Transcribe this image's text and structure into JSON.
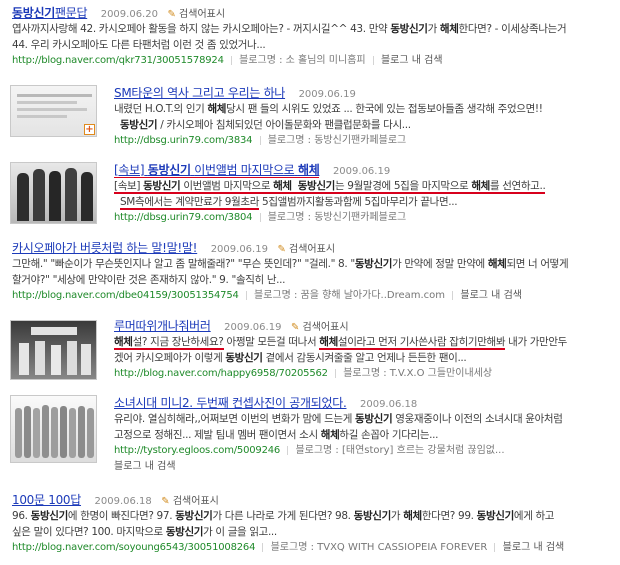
{
  "blog_search_label": "검색어표시",
  "blog_inside_search": "블로그 내 검색",
  "results": [
    {
      "title": "동방신기팬문답",
      "title_bold": "동방신기",
      "title_rest": "팬문답",
      "date": "2009.06.20",
      "line1": "엽사까지사랑해 42. 카시오페아 활동을 하지 않는 카시오페아는? - 꺼지시길^^ 43. 만약 동방신기가 해체한다면? - 이세상족나는거",
      "line2": "44. 우리 카시오페아도 다른 타팬처럼 이런 것 좀 있었거나...",
      "url": "http://blog.naver.com/qkr731/30051578924",
      "blogname": "블로그명 : 소 홀님의 미니홈피"
    },
    {
      "title": "SM타운의 역사 그리고 우리는 하나",
      "date": "2009.06.19",
      "line1": "내렸던 H.O.T.의 인기 해체당시 팬 들의 시위도 있었죠 ... 한국에 있는 접동보아들좀 생각해 주었으면!!",
      "line2": "동방신기 / 카시오페아 침체되있던 아이돌문화와 팬클럽문화를 다시...",
      "url": "http://dbsg.urin79.com/3834",
      "blogname": "블로그명 : 동방신기팬카페블로그"
    },
    {
      "title_prefix": "[속보]",
      "title_bold": "동방신기",
      "title_mid": "이번앨범 마지막으로",
      "title_bold2": "해체",
      "date": "2009.06.19",
      "line1": "[속보] 동방신기 이번앨범 마지막으로 해체 동방신기는 9월말경에 5집을 마지막으로 해체를 선연하고..",
      "line2": "SM측에서는 계약만료가 9월초라 5집앨범까지활동과함께 5집마무리가 끝나면...",
      "url": "http://dbsg.urin79.com/3804",
      "blogname": "블로그명 : 동방신기팬카페블로그"
    },
    {
      "title": "카시오페아가 버릇처럼 하는 말!말!말!",
      "date": "2009.06.19",
      "line1": "그만해.\" \"빠순이가 무슨뜻인지나 알고 좀 말해줄래?\" \"무슨 뜻인데?\" \"걸레.\" 8. \"동방신기가 만약에 정말 만약에 해체되면 너 어떻게",
      "line2": "할거야?\" \"세상에 만약이란 것은 존재하지 않아.\" 9. \"솔직히 난...",
      "url": "http://blog.naver.com/dbe04159/30051354754",
      "blogname": "블로그명 : 꿈을 향해 날아가다..Dream.com"
    },
    {
      "title": "루머따위개나줘버러",
      "date": "2009.06.19",
      "line1": "해체설? 지금 장난하세요? 아쩡말 모든걸 떠나서 해체설이라고 먼저 기사쓴사람 잡히기만해봐 내가 가만안두",
      "line2": "겠어 카시오페아가 이렇게 동방신기 곁에서 감동시켜줄줄 알고 언제나 든든한 팬이...",
      "url": "http://blog.naver.com/happy6958/70205562",
      "blogname": "블로그명 : T.V.X.O 그들만이내세상"
    },
    {
      "title": "소녀시대 미니2. 두번째 컨셉사진이 공개되었다.",
      "date": "2009.06.18",
      "line1": "유리야. 열심히해라,,어쩌보면 이번의 변화가 맘에 드는게 동방신기 영웅재중이나 이전의 소녀시대 윤아처럼",
      "line2": "고정으로 정해진... 제발 팀내 멤버 팬이면서 소시 해체하길 손꼽아 기다리는...",
      "url": "http://tystory.egloos.com/5009246",
      "blogname": "블로그명 : [태연story] 흐르는 강물처럼 끊임없..."
    },
    {
      "title": "100문 100답",
      "date": "2009.06.18",
      "line1": "96. 동방신기에 한명이 빠진다면? 97. 동방신기가 다른 나라로 가게 된다면? 98. 동방신기가 해체한다면? 99. 동방신기에게 하고",
      "line2": "싶은 말이 있다면? 100. 마지막으로 동방신기가 이 글을 읽고...",
      "url": "http://blog.naver.com/soyoung6543/30051008264",
      "blogname": "블로그명 : TVXQ WITH CASSIOPEIA FOREVER"
    }
  ]
}
